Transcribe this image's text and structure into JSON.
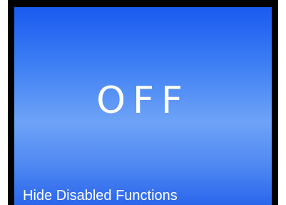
{
  "toggle": {
    "state_label": "OFF",
    "caption": "Hide Disabled Functions"
  },
  "colors": {
    "screen_top": "#1a5af0",
    "screen_mid": "#6ea3f7",
    "screen_bottom": "#2a66ec",
    "bezel": "#000000",
    "text": "#ffffff"
  }
}
